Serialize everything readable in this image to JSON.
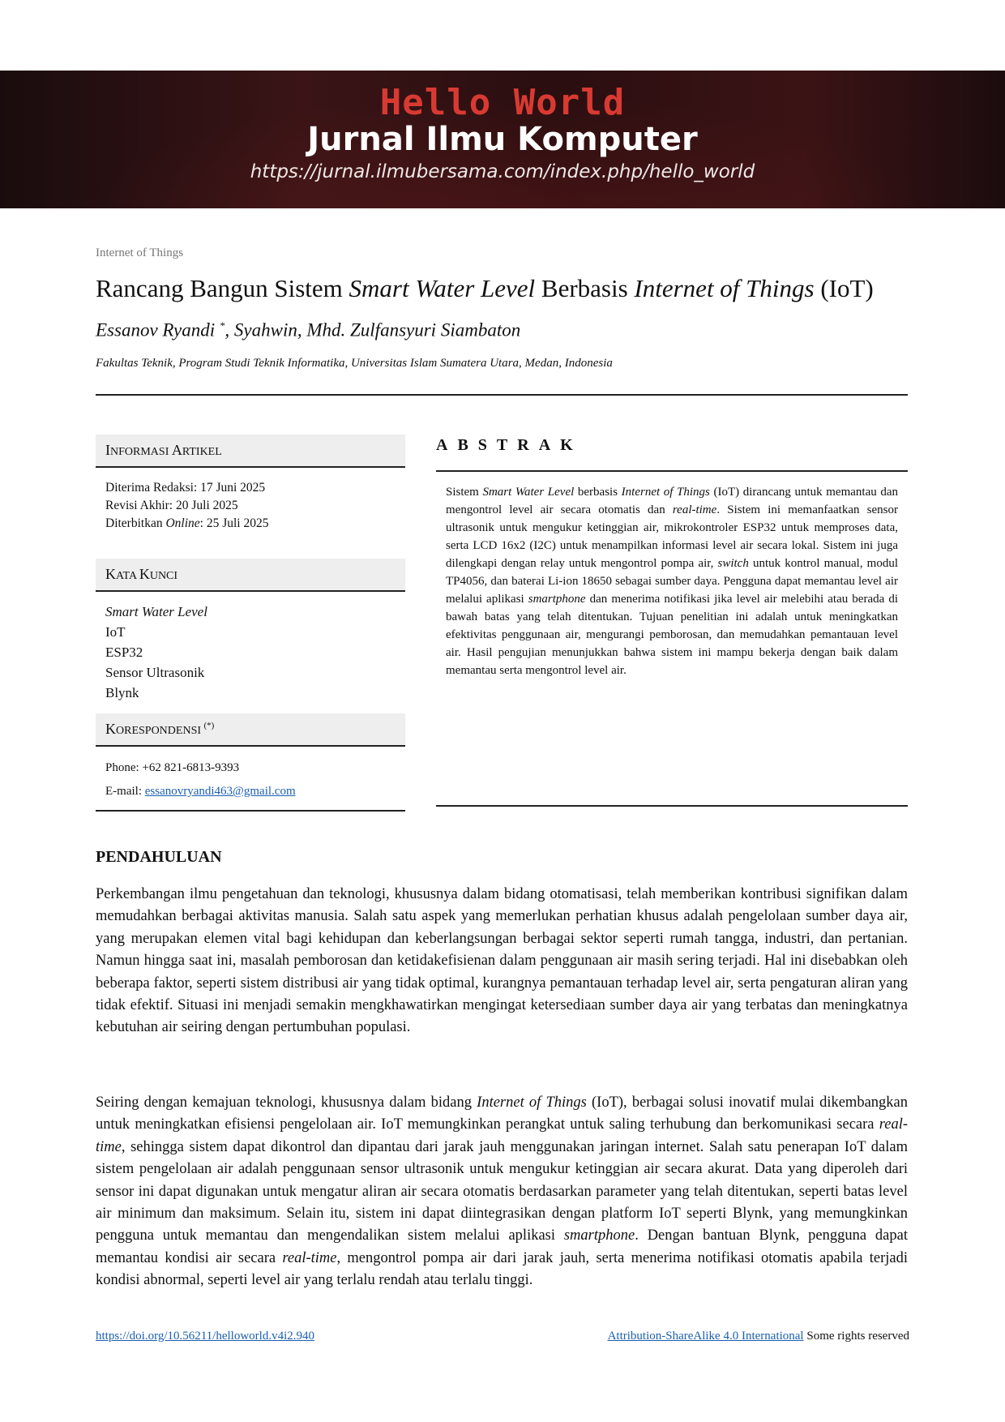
{
  "header": {
    "journal_name": "Hello World",
    "journal_subtitle": "Jurnal Ilmu Komputer",
    "journal_url": "https://jurnal.ilmubersama.com/index.php/hello_world"
  },
  "article": {
    "category": "Internet of Things",
    "title_parts": [
      "Rancang Bangun Sistem ",
      "Smart Water Level",
      " Berbasis ",
      "Internet of Things",
      " (IoT)"
    ],
    "authors_main": "Essanov Ryandi ",
    "authors_star": "*",
    "authors_rest": ", Syahwin, Mhd. Zulfansyuri Siambaton",
    "affiliation": "Fakultas Teknik, Program Studi Teknik Informatika, Universitas Islam Sumatera Utara, Medan, Indonesia"
  },
  "info": {
    "heading_big": "I",
    "heading_small": "NFORMASI ",
    "heading_big2": "A",
    "heading_small2": "RTIKEL",
    "received": "Diterima Redaksi: 17 Juni 2025",
    "revised": "Revisi Akhir: 20 Juli 2025",
    "published_pre": "Diterbitkan ",
    "published_it": "Online",
    "published_post": ": 25 Juli 2025"
  },
  "keywords": {
    "heading_big": "K",
    "heading_small": "ATA ",
    "heading_big2": "K",
    "heading_small2": "UNCI",
    "items": [
      "Smart Water Level",
      "IoT",
      "ESP32",
      "Sensor Ultrasonik",
      "Blynk"
    ]
  },
  "correspondence": {
    "heading_big": "K",
    "heading_small": "ORESPONDENSI ",
    "heading_sup": "(*)",
    "phone": "Phone: +62 821-6813-9393",
    "email_label": "E-mail: ",
    "email": "essanovryandi463@gmail.com"
  },
  "abstract": {
    "heading": "ABSTRAK",
    "text_parts": [
      "Sistem ",
      "Smart Water Level",
      " berbasis ",
      "Internet of Things",
      " (IoT) dirancang untuk memantau dan mengontrol level air secara otomatis dan ",
      "real-time",
      ". Sistem ini memanfaatkan sensor ultrasonik untuk mengukur ketinggian air, mikrokontroler ESP32 untuk memproses data, serta LCD 16x2 (I2C) untuk menampilkan informasi level air secara lokal. Sistem ini juga dilengkapi dengan relay untuk mengontrol pompa air, ",
      "switch",
      " untuk kontrol manual, modul TP4056, dan baterai Li-ion 18650 sebagai sumber daya. Pengguna dapat memantau level air melalui aplikasi ",
      "smartphone",
      " dan menerima notifikasi jika level air melebihi atau berada di bawah batas yang telah ditentukan. Tujuan penelitian ini adalah untuk meningkatkan efektivitas penggunaan air, mengurangi pemborosan, dan memudahkan pemantauan level air. Hasil pengujian menunjukkan bahwa sistem ini mampu bekerja dengan baik dalam memantau serta mengontrol level air."
    ]
  },
  "body": {
    "section_title": "PENDAHULUAN",
    "para1": "Perkembangan ilmu pengetahuan dan teknologi, khususnya dalam bidang otomatisasi, telah memberikan kontribusi signifikan dalam memudahkan berbagai aktivitas manusia. Salah satu aspek yang memerlukan perhatian khusus adalah pengelolaan sumber daya air, yang merupakan elemen vital bagi kehidupan dan keberlangsungan berbagai sektor seperti rumah tangga, industri, dan pertanian. Namun hingga saat ini, masalah pemborosan dan ketidakefisienan dalam penggunaan air masih sering terjadi. Hal ini disebabkan oleh beberapa faktor, seperti sistem distribusi air yang tidak optimal, kurangnya pemantauan terhadap level air, serta pengaturan aliran yang tidak efektif. Situasi ini menjadi semakin mengkhawatirkan mengingat ketersediaan sumber daya air yang terbatas dan meningkatnya kebutuhan air seiring dengan pertumbuhan populasi.",
    "para2_parts": [
      "Seiring dengan kemajuan teknologi, khususnya dalam bidang ",
      "Internet of Things",
      " (IoT), berbagai solusi inovatif mulai dikembangkan untuk meningkatkan efisiensi pengelolaan air. IoT memungkinkan perangkat untuk saling terhubung dan berkomunikasi secara ",
      "real-time",
      ", sehingga sistem dapat dikontrol dan dipantau dari jarak jauh menggunakan jaringan internet. Salah satu penerapan IoT dalam sistem pengelolaan air adalah penggunaan sensor ultrasonik untuk mengukur ketinggian air secara akurat. Data yang diperoleh dari sensor ini dapat digunakan untuk mengatur aliran air secara otomatis berdasarkan parameter yang telah ditentukan, seperti batas level air minimum dan maksimum. Selain itu, sistem ini dapat diintegrasikan dengan platform IoT seperti Blynk, yang memungkinkan pengguna untuk memantau dan mengendalikan sistem melalui aplikasi ",
      "smartphone",
      ". Dengan bantuan Blynk, pengguna dapat memantau kondisi air secara ",
      "real-time",
      ", mengontrol pompa air dari jarak jauh, serta menerima notifikasi otomatis apabila terjadi kondisi abnormal, seperti level air yang terlalu rendah atau terlalu tinggi."
    ]
  },
  "footer": {
    "doi": "https://doi.org/10.56211/helloworld.v4i2.940",
    "license": "Attribution-ShareAlike 4.0 International",
    "rights": " Some rights reserved"
  }
}
